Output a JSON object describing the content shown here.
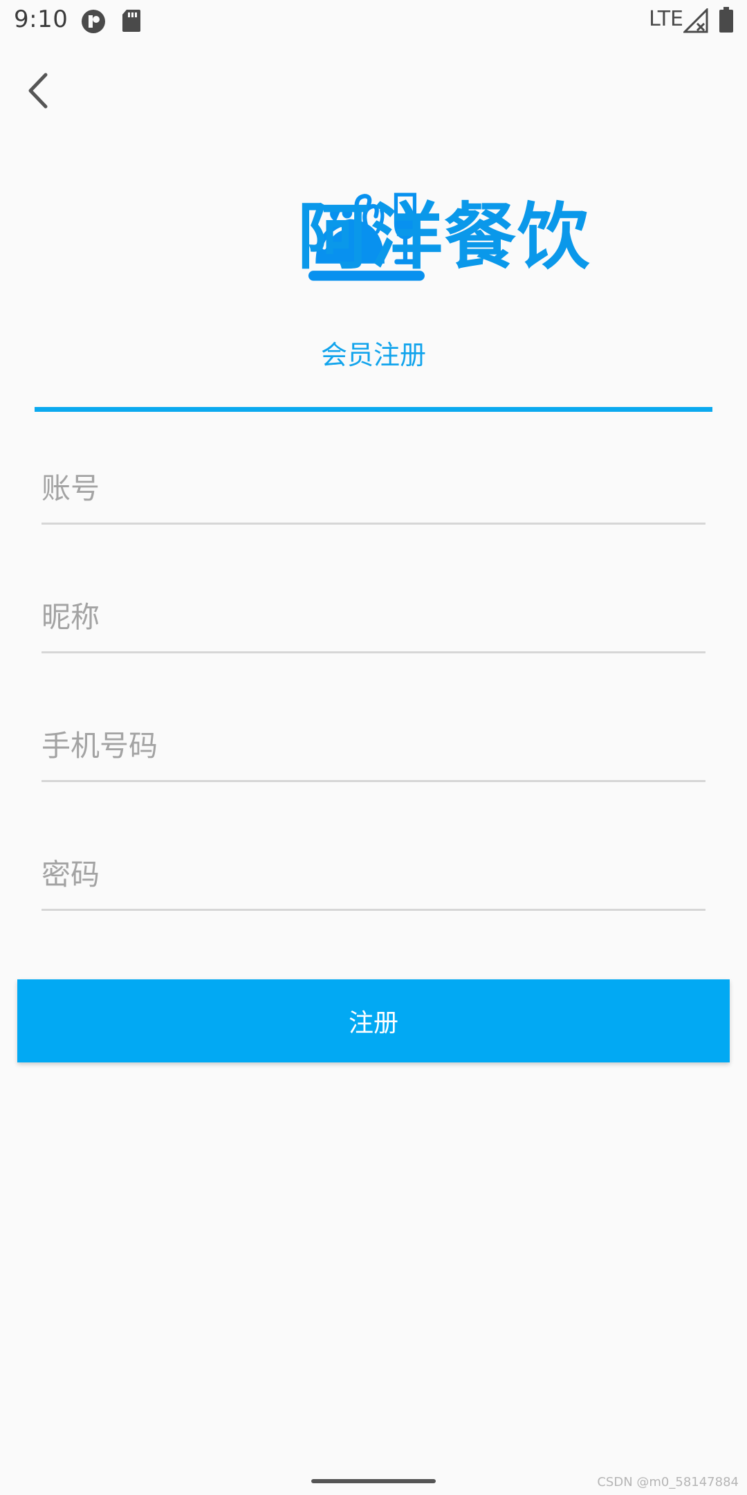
{
  "status_bar": {
    "time": "9:10",
    "network": "LTE",
    "icons": [
      "app-circle-icon",
      "sd-card-icon",
      "signal-off-icon",
      "battery-icon"
    ]
  },
  "header": {
    "back_icon": "chevron-left-icon"
  },
  "brand": {
    "name": "阿洋餐饮",
    "logo_icon": "cloche-wine-icon",
    "color": "#0a98ea"
  },
  "tab": {
    "label": "会员注册",
    "indicator_color": "#0ba9ef"
  },
  "form": {
    "account": {
      "placeholder": "账号",
      "value": ""
    },
    "nickname": {
      "placeholder": "昵称",
      "value": ""
    },
    "phone": {
      "placeholder": "手机号码",
      "value": ""
    },
    "password": {
      "placeholder": "密码",
      "value": ""
    }
  },
  "submit": {
    "label": "注册",
    "color": "#02a9f3"
  },
  "watermark": "CSDN @m0_58147884"
}
